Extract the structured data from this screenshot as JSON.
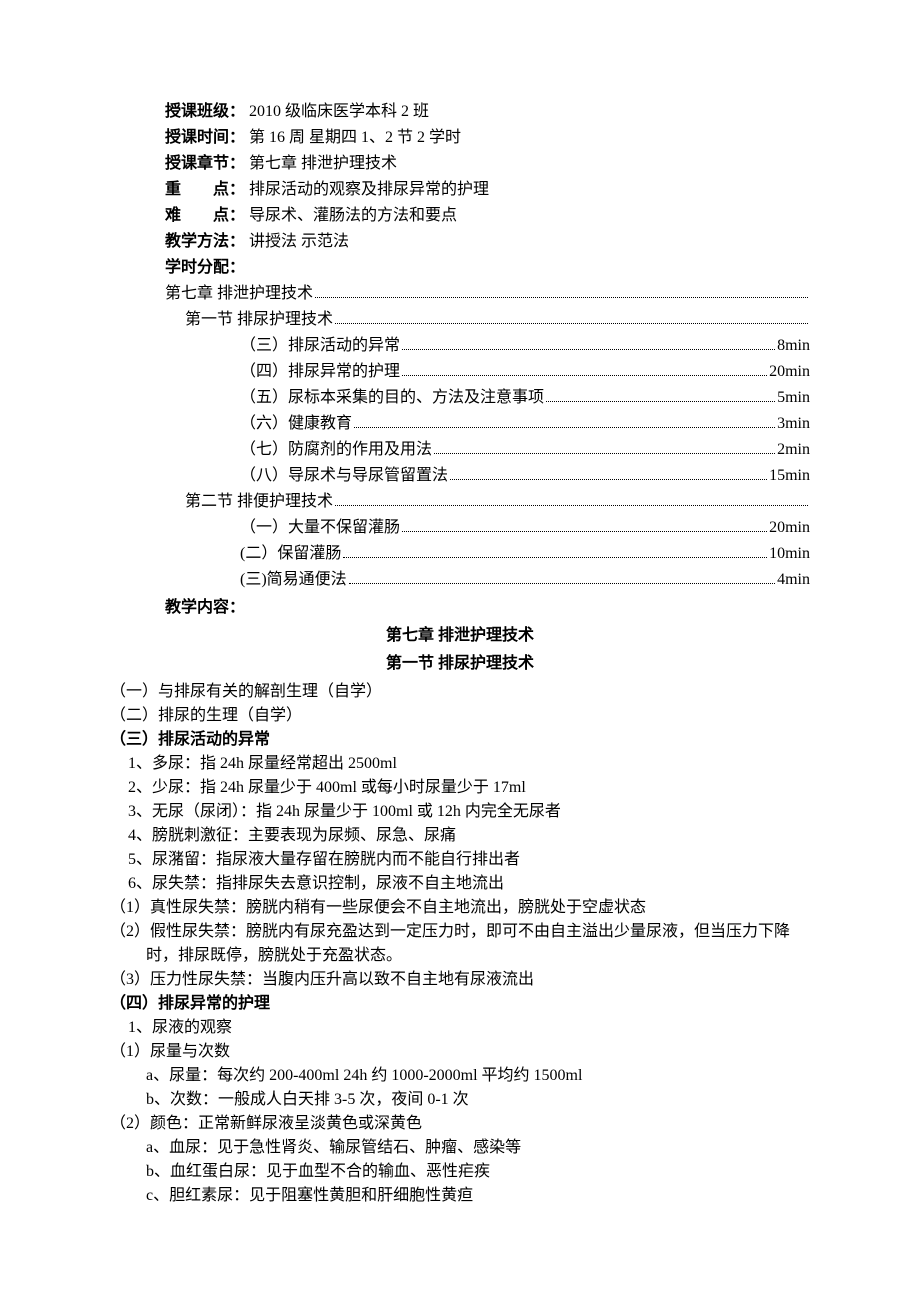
{
  "meta": {
    "class_label": "授课班级：",
    "class_value": "2010 级临床医学本科 2 班",
    "time_label": "授课时间：",
    "time_value": "第 16 周 星期四 1、2 节    2 学时",
    "chapter_label": "授课章节：",
    "chapter_value": "第七章    排泄护理技术",
    "key_label": "重        点：",
    "key_value": "排尿活动的观察及排尿异常的护理",
    "diff_label": "难        点：",
    "diff_value": "导尿术、灌肠法的方法和要点",
    "method_label": "教学方法：",
    "method_value": "讲授法        示范法",
    "alloc_label": "学时分配：",
    "content_label": "教学内容："
  },
  "toc": [
    {
      "indent": 55,
      "label": "第七章    排泄护理技术",
      "time": ""
    },
    {
      "indent": 75,
      "label": "第一节    排尿护理技术",
      "time": ""
    },
    {
      "indent": 130,
      "label": "（三）排尿活动的异常",
      "time": "8min"
    },
    {
      "indent": 130,
      "label": "（四）排尿异常的护理",
      "time": "20min"
    },
    {
      "indent": 130,
      "label": "（五）尿标本采集的目的、方法及注意事项",
      "time": "5min"
    },
    {
      "indent": 130,
      "label": "（六）健康教育",
      "time": "3min"
    },
    {
      "indent": 130,
      "label": "（七）防腐剂的作用及用法",
      "time": "2min"
    },
    {
      "indent": 130,
      "label": "（八）导尿术与导尿管留置法",
      "time": "15min"
    },
    {
      "indent": 75,
      "label": "第二节    排便护理技术",
      "time": ""
    },
    {
      "indent": 130,
      "label": "（一）大量不保留灌肠",
      "time": "20min"
    },
    {
      "indent": 130,
      "label": "(二）保留灌肠",
      "time": "10min"
    },
    {
      "indent": 130,
      "label": "(三)简易通便法",
      "time": "4min"
    }
  ],
  "titles": {
    "chapter": "第七章    排泄护理技术",
    "section1": "第一节    排尿护理技术"
  },
  "body": [
    {
      "cls": "body-line",
      "text": "（一）与排尿有关的解剖生理（自学）"
    },
    {
      "cls": "body-line",
      "text": "（二）排尿的生理（自学）"
    },
    {
      "cls": "body-line bold",
      "text": "（三）排尿活动的异常"
    },
    {
      "cls": "body-indent-1",
      "text": "1、多尿：指 24h 尿量经常超出 2500ml"
    },
    {
      "cls": "body-indent-1",
      "text": "2、少尿：指 24h 尿量少于 400ml 或每小时尿量少于 17ml"
    },
    {
      "cls": "body-indent-1",
      "text": "3、无尿（尿闭）：指 24h 尿量少于 100ml 或 12h 内完全无尿者"
    },
    {
      "cls": "body-indent-1",
      "text": "4、膀胱刺激征：主要表现为尿频、尿急、尿痛"
    },
    {
      "cls": "body-indent-1",
      "text": "5、尿潴留：指尿液大量存留在膀胱内而不能自行排出者"
    },
    {
      "cls": "body-indent-1",
      "text": "6、尿失禁：指排尿失去意识控制，尿液不自主地流出"
    },
    {
      "cls": "body-line",
      "text": "（1）真性尿失禁：膀胱内稍有一些尿便会不自主地流出，膀胱处于空虚状态"
    },
    {
      "cls": "body-line hang",
      "text": "（2）假性尿失禁：膀胱内有尿充盈达到一定压力时，即可不由自主溢出少量尿液，但当压力下降时，排尿既停，膀胱处于充盈状态。"
    },
    {
      "cls": "body-line",
      "text": "（3）压力性尿失禁：当腹内压升高以致不自主地有尿液流出"
    },
    {
      "cls": "body-line bold",
      "text": "（四）排尿异常的护理"
    },
    {
      "cls": "body-indent-1",
      "text": "1、尿液的观察"
    },
    {
      "cls": "body-line",
      "text": "（1）尿量与次数"
    },
    {
      "cls": "body-indent-2",
      "text": "a、尿量：每次约 200-400ml    24h 约 1000-2000ml    平均约 1500ml"
    },
    {
      "cls": "body-indent-2",
      "text": "b、次数：一般成人白天排 3-5 次，夜间 0-1 次"
    },
    {
      "cls": "body-line",
      "text": "（2）颜色：正常新鲜尿液呈淡黄色或深黄色"
    },
    {
      "cls": "body-indent-2",
      "text": "a、血尿：见于急性肾炎、输尿管结石、肿瘤、感染等"
    },
    {
      "cls": "body-indent-2",
      "text": "b、血红蛋白尿：见于血型不合的输血、恶性疟疾"
    },
    {
      "cls": "body-indent-2",
      "text": "c、胆红素尿：见于阻塞性黄胆和肝细胞性黄疸"
    }
  ]
}
